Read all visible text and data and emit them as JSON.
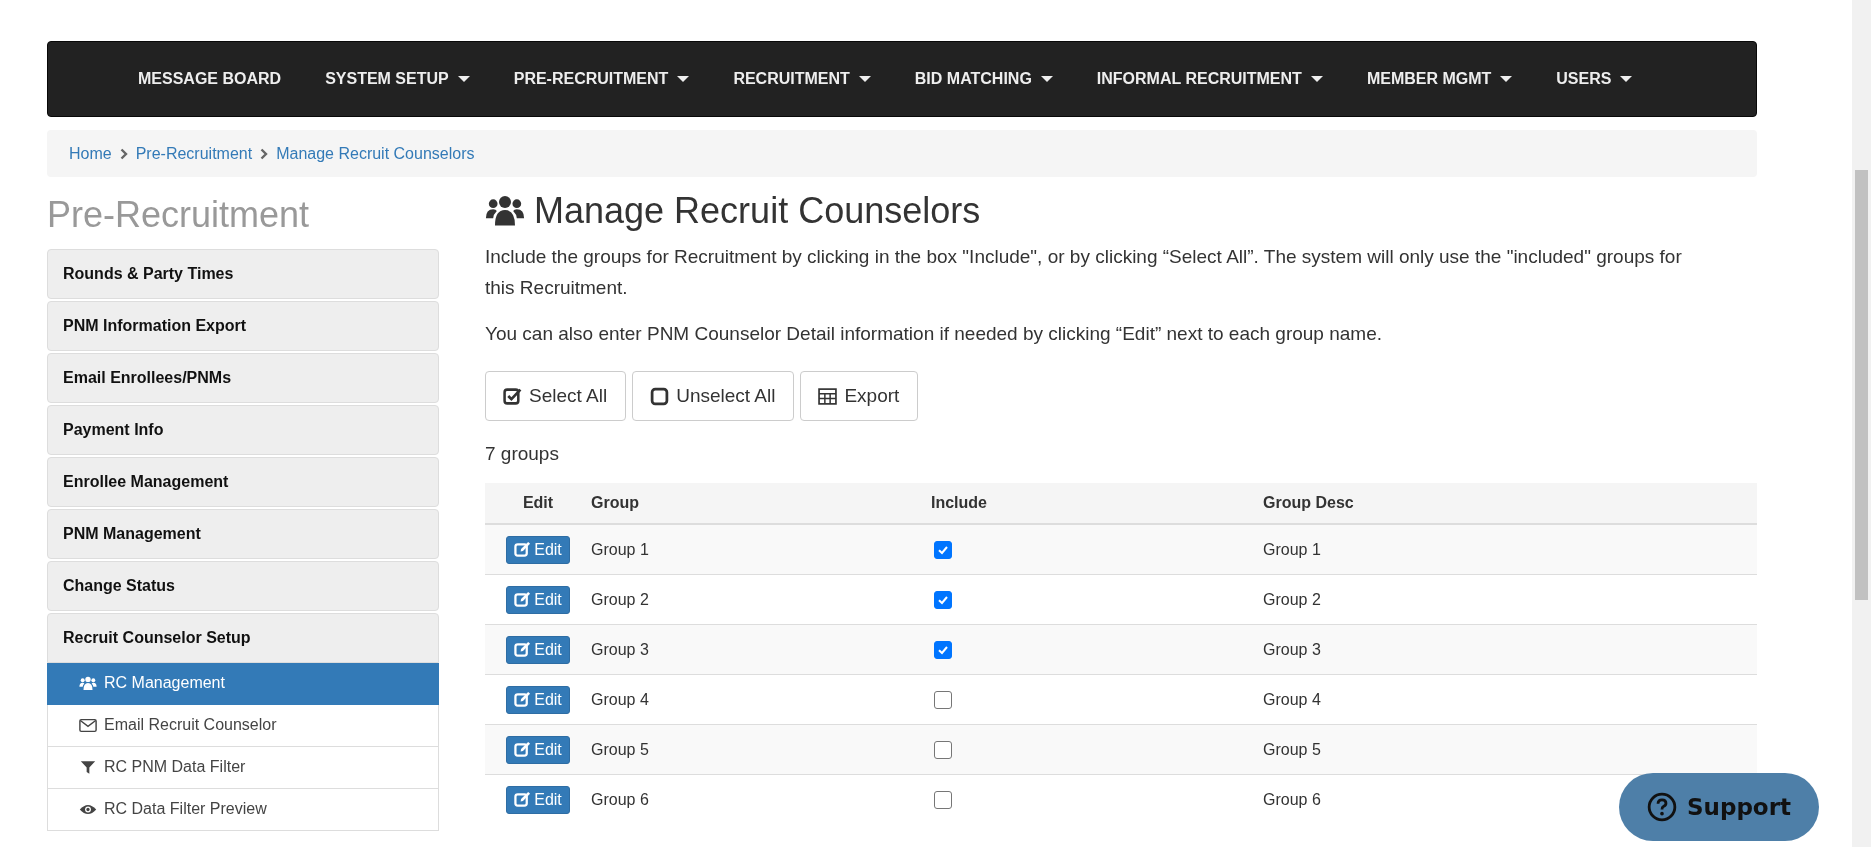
{
  "nav": [
    {
      "label": "MESSAGE BOARD",
      "dropdown": false
    },
    {
      "label": "SYSTEM SETUP",
      "dropdown": true
    },
    {
      "label": "PRE-RECRUITMENT",
      "dropdown": true
    },
    {
      "label": "RECRUITMENT",
      "dropdown": true
    },
    {
      "label": "BID MATCHING",
      "dropdown": true
    },
    {
      "label": "INFORMAL RECRUITMENT",
      "dropdown": true
    },
    {
      "label": "MEMBER MGMT",
      "dropdown": true
    },
    {
      "label": "USERS",
      "dropdown": true
    }
  ],
  "breadcrumb": [
    "Home",
    "Pre-Recruitment",
    "Manage Recruit Counselors"
  ],
  "sidebar": {
    "title": "Pre-Recruitment",
    "items": [
      {
        "label": "Rounds & Party Times",
        "expanded": false
      },
      {
        "label": "PNM Information Export",
        "expanded": false
      },
      {
        "label": "Email Enrollees/PNMs",
        "expanded": false
      },
      {
        "label": "Payment Info",
        "expanded": false
      },
      {
        "label": "Enrollee Management",
        "expanded": false
      },
      {
        "label": "PNM Management",
        "expanded": false
      },
      {
        "label": "Change Status",
        "expanded": false
      },
      {
        "label": "Recruit Counselor Setup",
        "expanded": true,
        "children": [
          {
            "label": "RC Management",
            "kind": "users",
            "selected": true
          },
          {
            "label": "Email Recruit Counselor",
            "kind": "envelope",
            "selected": false
          },
          {
            "label": "RC PNM Data Filter",
            "kind": "filter",
            "selected": false
          },
          {
            "label": "RC Data Filter Preview",
            "kind": "eye",
            "selected": false
          }
        ]
      }
    ]
  },
  "heading": "Manage Recruit Counselors",
  "intro": [
    "Include the groups for Recruitment by clicking in the box \"Include\", or by clicking “Select All”. The system will only use the \"included\" groups for this Recruitment.",
    "You can also enter PNM Counselor Detail information if needed by clicking “Edit” next to each group name."
  ],
  "actions": [
    {
      "label": "Select All",
      "kind": "check"
    },
    {
      "label": "Unselect All",
      "kind": "square"
    },
    {
      "label": "Export",
      "kind": "table"
    }
  ],
  "count": "7 groups",
  "table": {
    "columns": [
      "Edit",
      "Group",
      "Include",
      "Group Desc"
    ],
    "rows": [
      {
        "edit": "Edit",
        "group": "Group 1",
        "include": true,
        "desc": "Group 1"
      },
      {
        "edit": "Edit",
        "group": "Group 2",
        "include": true,
        "desc": "Group 2"
      },
      {
        "edit": "Edit",
        "group": "Group 3",
        "include": true,
        "desc": "Group 3"
      },
      {
        "edit": "Edit",
        "group": "Group 4",
        "include": false,
        "desc": "Group 4"
      },
      {
        "edit": "Edit",
        "group": "Group 5",
        "include": false,
        "desc": "Group 5"
      },
      {
        "edit": "Edit",
        "group": "Group 6",
        "include": false,
        "desc": "Group 6"
      }
    ]
  },
  "support": "Support"
}
